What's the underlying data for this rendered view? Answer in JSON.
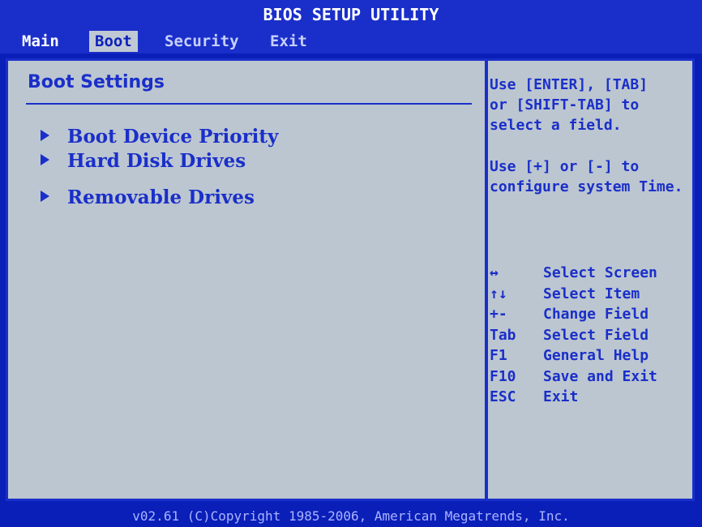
{
  "title": "BIOS SETUP UTILITY",
  "menu": {
    "tabs": [
      {
        "label": "Main"
      },
      {
        "label": "Boot"
      },
      {
        "label": "Security"
      },
      {
        "label": "Exit"
      }
    ],
    "active": "Boot"
  },
  "main": {
    "section_title": "Boot Settings",
    "items": [
      {
        "label": "Boot Device Priority"
      },
      {
        "label": "Hard Disk Drives"
      },
      {
        "label": "Removable Drives"
      }
    ]
  },
  "help": {
    "text1": "Use [ENTER], [TAB]\nor [SHIFT-TAB] to\nselect a field.",
    "text2": "Use [+] or [-] to\nconfigure system Time."
  },
  "keys": [
    {
      "key": "↔",
      "desc": "Select Screen"
    },
    {
      "key": "↑↓",
      "desc": "Select Item"
    },
    {
      "key": "+-",
      "desc": "Change Field"
    },
    {
      "key": "Tab",
      "desc": "Select Field"
    },
    {
      "key": "F1",
      "desc": "General Help"
    },
    {
      "key": "F10",
      "desc": "Save and Exit"
    },
    {
      "key": "ESC",
      "desc": "Exit"
    }
  ],
  "footer": "v02.61 (C)Copyright 1985-2006, American Megatrends, Inc."
}
